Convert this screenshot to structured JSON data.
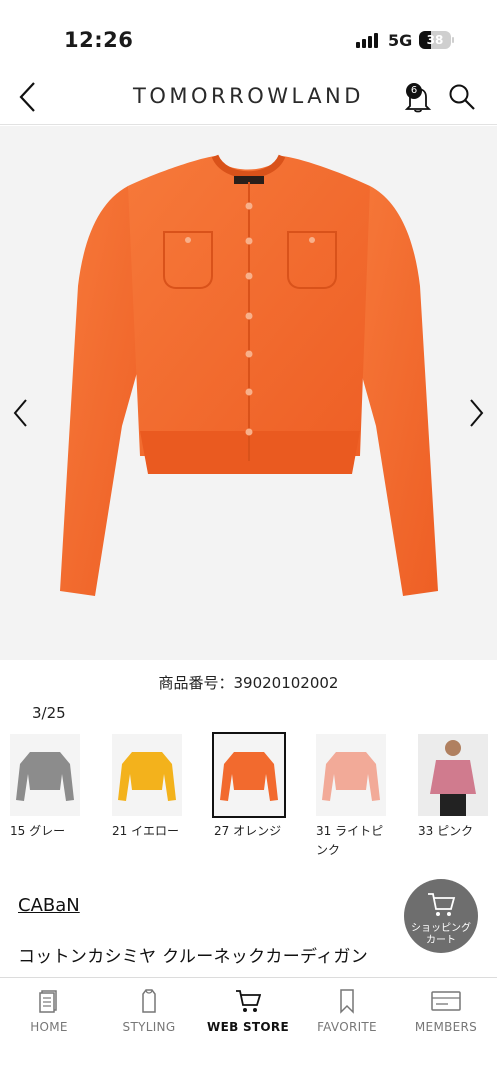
{
  "status_bar": {
    "time": "12:26",
    "network": "5G",
    "battery": "38",
    "battery_fraction": 0.38
  },
  "header": {
    "brand": "TOMORROWLAND",
    "notification_count": "6",
    "icons": [
      "back-chevron-icon",
      "bell-icon",
      "search-icon"
    ]
  },
  "product": {
    "image_alt_color": "#f26a2e",
    "number_text": "商品番号：39020102002",
    "image_counter": "3/25",
    "brand_link": "CABaN",
    "title": "コットンカシミヤ クルーネックカーディガン"
  },
  "colors": [
    {
      "label": "15 グレー",
      "color": "#8c8c8c",
      "selected": false
    },
    {
      "label": "21 イエロー",
      "color": "#f3b21c",
      "selected": false
    },
    {
      "label": "27 オレンジ",
      "color": "#f26a2e",
      "selected": true
    },
    {
      "label": "31 ライトピンク",
      "label_line1": "31 ライトピ",
      "label_line2": "ンク",
      "color": "#f2aa98",
      "selected": false
    },
    {
      "label": "33 ピンク",
      "color": "#d07b8e",
      "selected": false
    }
  ],
  "cart_button": {
    "line1": "ショッピング",
    "line2": "カート"
  },
  "bottom_nav": [
    {
      "label": "HOME",
      "icon": "home-icon",
      "active": false
    },
    {
      "label": "STYLING",
      "icon": "hanger-icon",
      "active": false
    },
    {
      "label": "WEB STORE",
      "icon": "cart-icon",
      "active": true
    },
    {
      "label": "FAVORITE",
      "icon": "bookmark-icon",
      "active": false
    },
    {
      "label": "MEMBERS",
      "icon": "member-card-icon",
      "active": false
    }
  ]
}
